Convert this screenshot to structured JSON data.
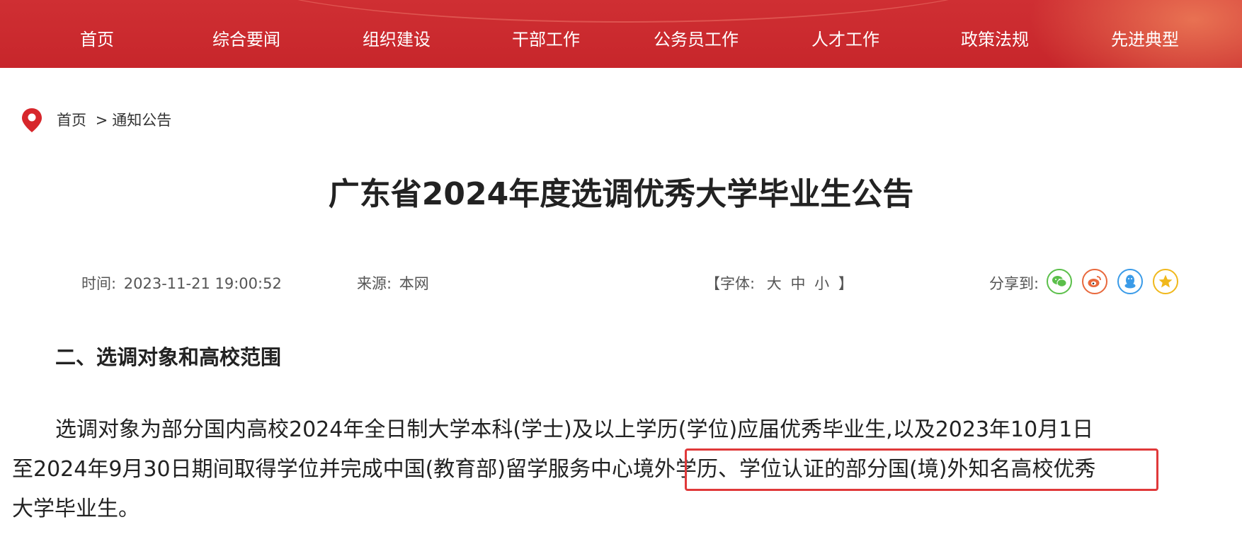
{
  "nav": {
    "items": [
      "首页",
      "综合要闻",
      "组织建设",
      "干部工作",
      "公务员工作",
      "人才工作",
      "政策法规",
      "先进典型"
    ]
  },
  "breadcrumb": {
    "home": "首页",
    "separator": ">",
    "current": "通知公告"
  },
  "article": {
    "title": "广东省2024年度选调优秀大学毕业生公告",
    "time_label": "时间:",
    "time_value": "2023-11-21 19:00:52",
    "source_label": "来源:",
    "source_value": "本网",
    "font_size_prefix": "【字体:",
    "font_large": "大",
    "font_medium": "中",
    "font_small": "小",
    "font_size_suffix": "】",
    "share_label": "分享到:",
    "section_heading": "二、选调对象和高校范围",
    "paragraph_line1": "选调对象为部分国内高校2024年全日制大学本科(学士)及以上学历(学位)应届优秀毕业生,以及2023年10月1日",
    "paragraph_line2a": "至2024年9月30日期间取得学位并完成中国(教育部)留学服务中心",
    "paragraph_line2b": "境外学历、学位认证的部分国(境)外知名高校",
    "paragraph_line2c": "优秀",
    "paragraph_line3": "大学毕业生。"
  },
  "share_icons": [
    {
      "name": "wechat-icon",
      "color": "#5bbf4a"
    },
    {
      "name": "weibo-icon",
      "color": "#e8683c"
    },
    {
      "name": "qq-icon",
      "color": "#3a9be8"
    },
    {
      "name": "qzone-icon",
      "color": "#f0b81c"
    }
  ],
  "colors": {
    "nav_bg": "#c9282d",
    "pin": "#d7262b",
    "highlight_border": "#e0393a"
  }
}
